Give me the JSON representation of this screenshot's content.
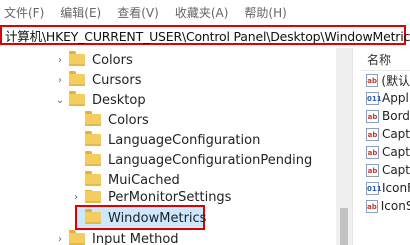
{
  "menu": [
    {
      "label": "文件(F)"
    },
    {
      "label": "编辑(E)"
    },
    {
      "label": "查看(V)"
    },
    {
      "label": "收藏夹(A)"
    },
    {
      "label": "帮助(H)"
    }
  ],
  "address": {
    "path": "计算机\\HKEY_CURRENT_USER\\Control Panel\\Desktop\\WindowMetrics"
  },
  "tree": {
    "items": [
      {
        "label": "Colors",
        "arrow": "›"
      },
      {
        "label": "Cursors",
        "arrow": "›"
      },
      {
        "label": "Desktop",
        "arrow": "⌄"
      },
      {
        "label": "Colors",
        "arrow": ""
      },
      {
        "label": "LanguageConfiguration",
        "arrow": ""
      },
      {
        "label": "LanguageConfigurationPending",
        "arrow": ""
      },
      {
        "label": "MuiCached",
        "arrow": ""
      },
      {
        "label": "PerMonitorSettings",
        "arrow": "›"
      },
      {
        "label": "WindowMetrics",
        "arrow": ""
      },
      {
        "label": "Input Method",
        "arrow": "›"
      }
    ]
  },
  "values_pane": {
    "header": "名称",
    "rows": [
      {
        "icon": "ab",
        "name": "(默认"
      },
      {
        "icon": "011",
        "name": "Appl"
      },
      {
        "icon": "ab",
        "name": "Bord"
      },
      {
        "icon": "ab",
        "name": "Capt"
      },
      {
        "icon": "ab",
        "name": "Capt"
      },
      {
        "icon": "ab",
        "name": "Capt"
      },
      {
        "icon": "011",
        "name": "IconF"
      },
      {
        "icon": "ab",
        "name": "IconS"
      }
    ]
  }
}
